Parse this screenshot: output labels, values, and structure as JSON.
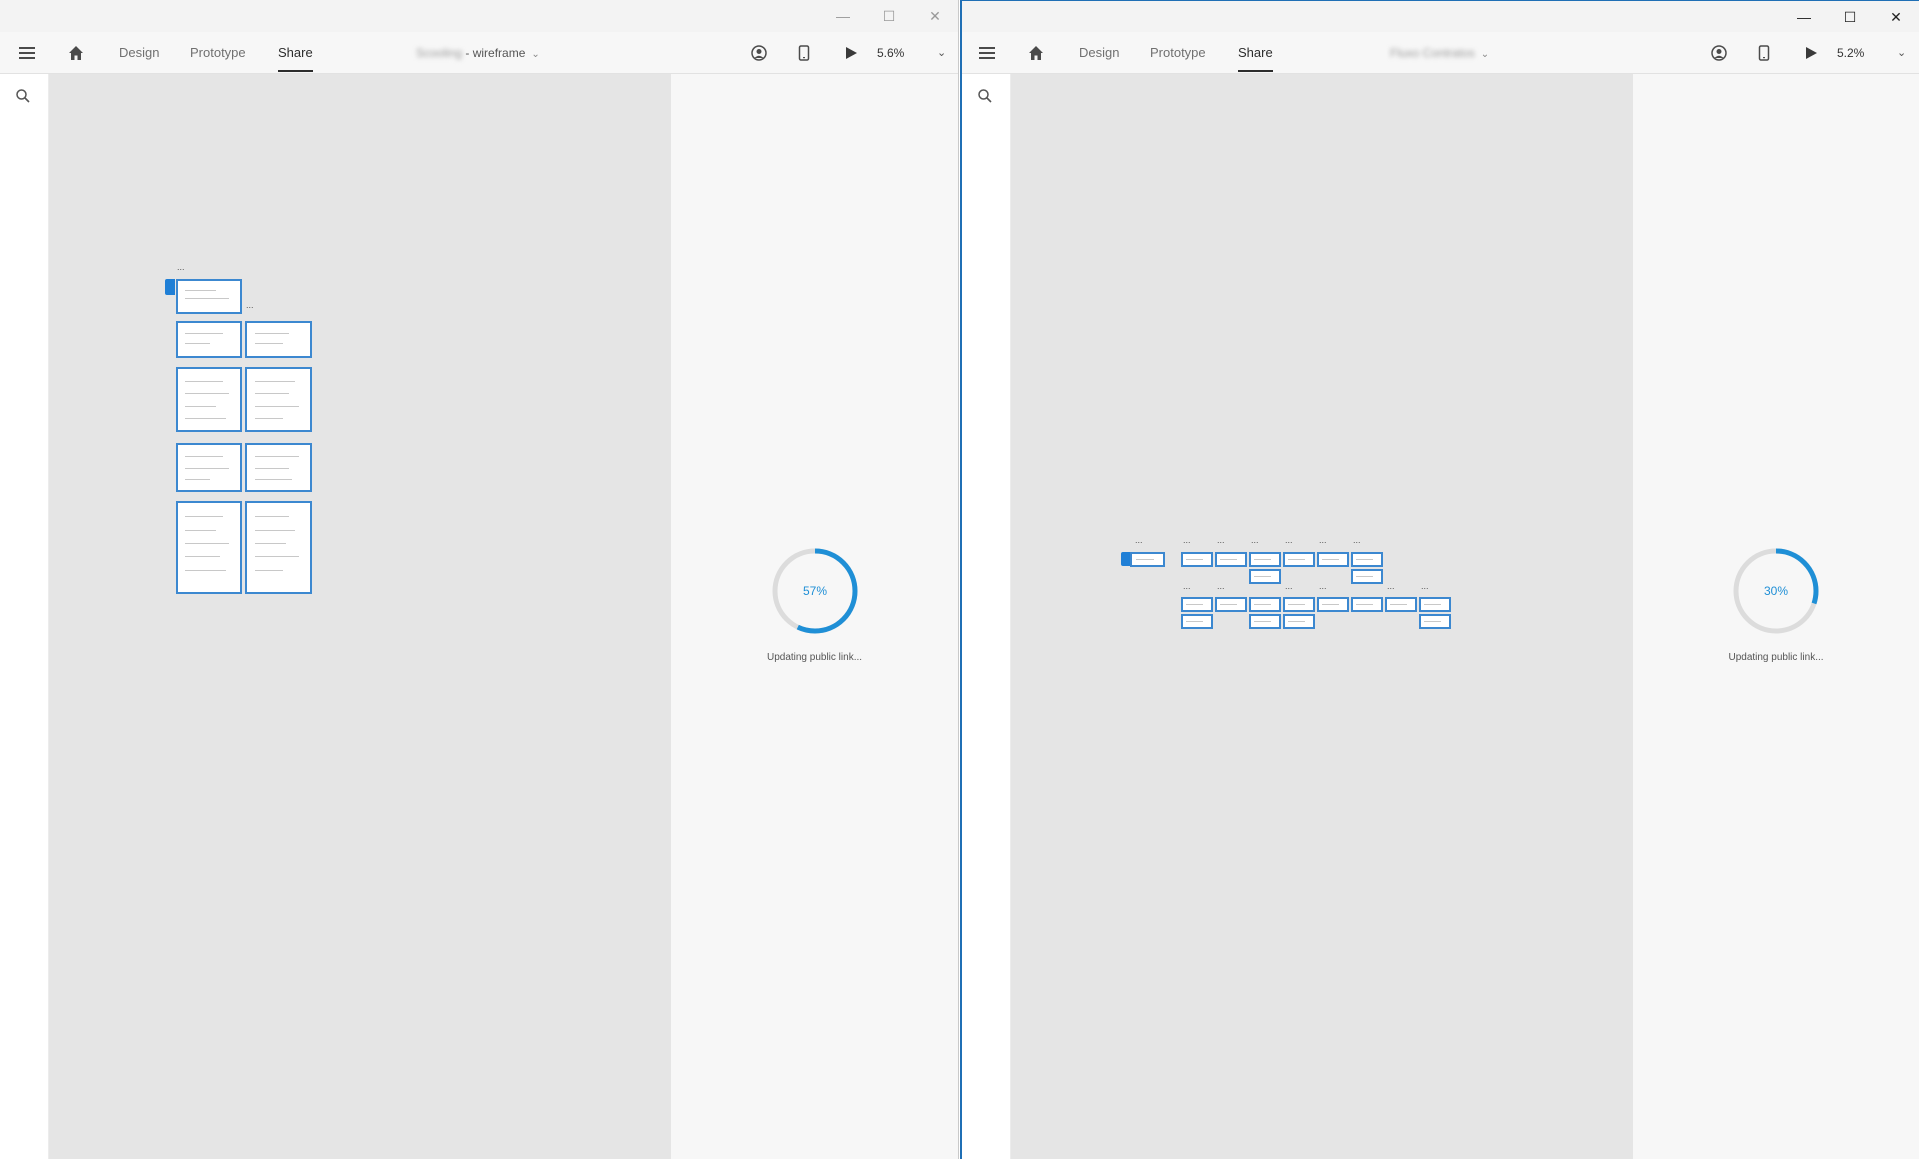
{
  "windows": [
    {
      "tabs": [
        "Design",
        "Prototype",
        "Share"
      ],
      "active_tab": "Share",
      "doc_title_blurred": "Scooling",
      "doc_title_suffix": " - wireframe",
      "zoom": "5.6%",
      "progress_percent": 57,
      "progress_label": "57%",
      "progress_caption": "Updating public link...",
      "artboard_label": "..."
    },
    {
      "tabs": [
        "Design",
        "Prototype",
        "Share"
      ],
      "active_tab": "Share",
      "doc_title_blurred": "Fluxo Contratos",
      "doc_title_suffix": "",
      "zoom": "5.2%",
      "progress_percent": 30,
      "progress_label": "30%",
      "progress_caption": "Updating public link...",
      "artboard_label": "..."
    }
  ],
  "icons": {
    "menu": "hamburger-menu-icon",
    "home": "home-icon",
    "user": "user-icon",
    "device": "mobile-device-icon",
    "play": "play-icon",
    "search": "search-icon",
    "minimize": "minimize-icon",
    "maximize": "maximize-icon",
    "close": "close-icon",
    "chevron": "chevron-down-icon"
  },
  "colors": {
    "accent": "#1f8fd6",
    "artboard_border": "#3c88d0",
    "canvas": "#e5e5e5",
    "track": "#dcdcdc"
  }
}
